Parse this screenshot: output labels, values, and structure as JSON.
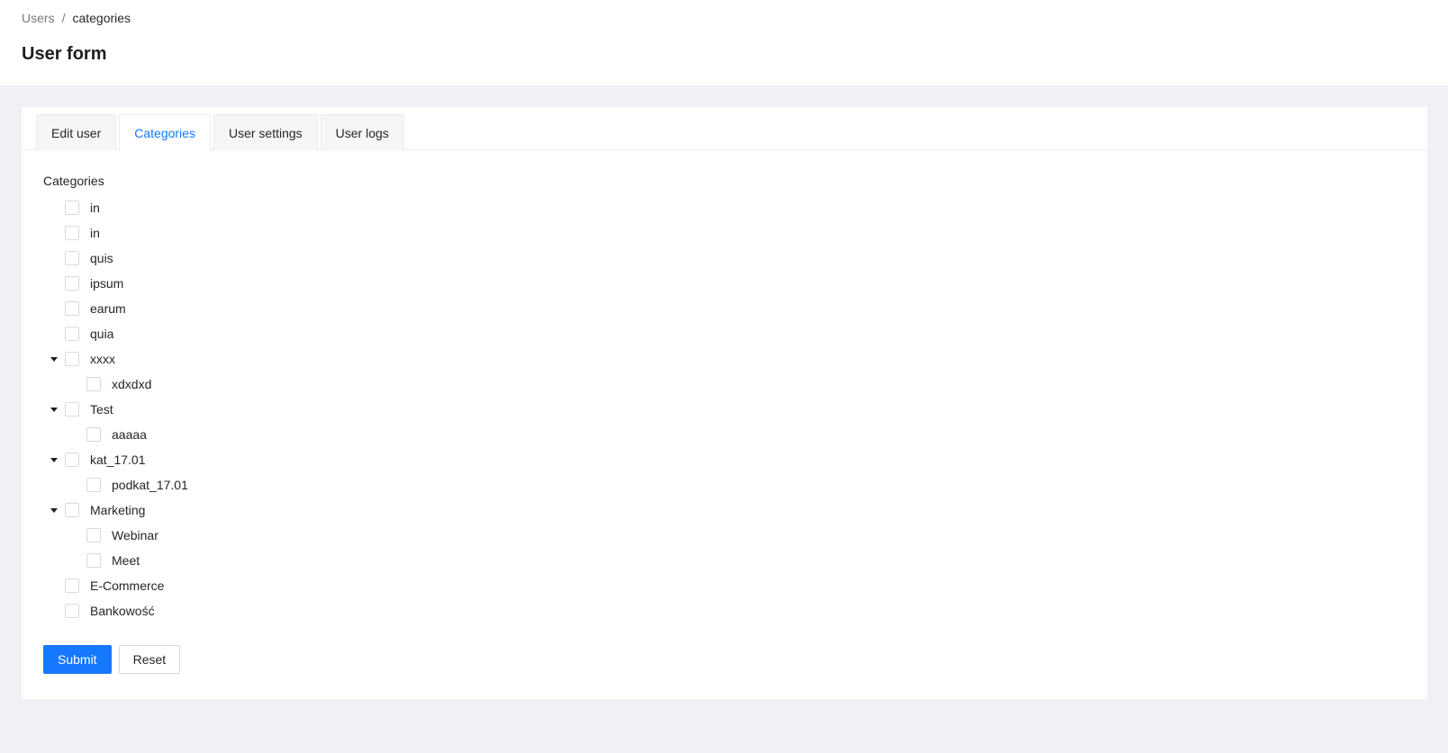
{
  "header": {
    "breadcrumb": {
      "parent": "Users",
      "separator": "/",
      "current": "categories"
    },
    "title": "User form"
  },
  "tabs": [
    {
      "label": "Edit user",
      "active": false
    },
    {
      "label": "Categories",
      "active": true
    },
    {
      "label": "User settings",
      "active": false
    },
    {
      "label": "User logs",
      "active": false
    }
  ],
  "form": {
    "label": "Categories",
    "tree": [
      {
        "label": "in",
        "level": 0,
        "expandable": false,
        "checked": false
      },
      {
        "label": "in",
        "level": 0,
        "expandable": false,
        "checked": false
      },
      {
        "label": "quis",
        "level": 0,
        "expandable": false,
        "checked": false
      },
      {
        "label": "ipsum",
        "level": 0,
        "expandable": false,
        "checked": false
      },
      {
        "label": "earum",
        "level": 0,
        "expandable": false,
        "checked": false
      },
      {
        "label": "quia",
        "level": 0,
        "expandable": false,
        "checked": false
      },
      {
        "label": "xxxx",
        "level": 0,
        "expandable": true,
        "expanded": true,
        "checked": false
      },
      {
        "label": "xdxdxd",
        "level": 1,
        "expandable": false,
        "checked": false
      },
      {
        "label": "Test",
        "level": 0,
        "expandable": true,
        "expanded": true,
        "checked": false
      },
      {
        "label": "aaaaa",
        "level": 1,
        "expandable": false,
        "checked": false
      },
      {
        "label": "kat_17.01",
        "level": 0,
        "expandable": true,
        "expanded": true,
        "checked": false
      },
      {
        "label": "podkat_17.01",
        "level": 1,
        "expandable": false,
        "checked": false
      },
      {
        "label": "Marketing",
        "level": 0,
        "expandable": true,
        "expanded": true,
        "checked": false
      },
      {
        "label": "Webinar",
        "level": 1,
        "expandable": false,
        "checked": false
      },
      {
        "label": "Meet",
        "level": 1,
        "expandable": false,
        "checked": false
      },
      {
        "label": "E-Commerce",
        "level": 0,
        "expandable": false,
        "checked": false
      },
      {
        "label": "Bankowość",
        "level": 0,
        "expandable": false,
        "checked": false
      }
    ],
    "submit_label": "Submit",
    "reset_label": "Reset"
  },
  "colors": {
    "primary": "#1677ff",
    "page_bg": "#f0f1f4",
    "surface": "#ffffff"
  },
  "icons": {
    "expand": "caret-down-icon",
    "checkbox": "checkbox-unchecked-icon"
  }
}
